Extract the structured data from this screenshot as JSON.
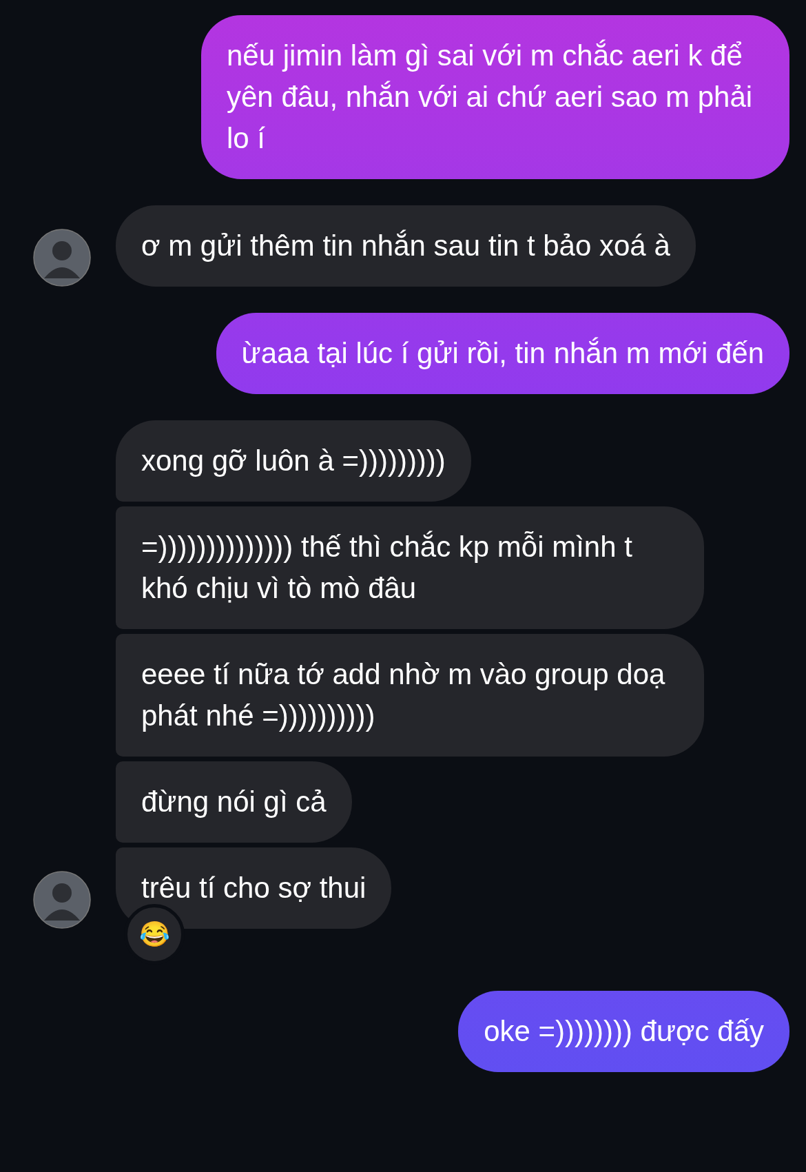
{
  "messages": [
    {
      "kind": "outgoing",
      "text": "nếu jimin làm gì sai với m chắc aeri k để yên đâu, nhắn với ai chứ aeri sao m phải lo í"
    },
    {
      "kind": "incoming",
      "text": "ơ m gửi thêm tin nhắn sau tin t bảo xoá à",
      "avatar": true
    },
    {
      "kind": "outgoing",
      "text": "ừaaa tại lúc í gửi rồi, tin nhắn m mới đến"
    },
    {
      "kind": "incoming",
      "text": "xong gỡ luôn à =)))))))))",
      "avatar": false
    },
    {
      "kind": "incoming",
      "text": "=)))))))))))))) thế thì chắc kp mỗi mình t khó chịu vì tò mò đâu",
      "avatar": false
    },
    {
      "kind": "incoming",
      "text": "eeee tí nữa tớ add nhờ m vào group doạ phát nhé =))))))))))",
      "avatar": false
    },
    {
      "kind": "incoming",
      "text": "đừng nói gì cả",
      "avatar": false
    },
    {
      "kind": "incoming",
      "text": "trêu tí cho sợ thui",
      "avatar": true,
      "reaction": "😂"
    },
    {
      "kind": "outgoing",
      "text": "oke =)))))))) được đấy"
    }
  ]
}
